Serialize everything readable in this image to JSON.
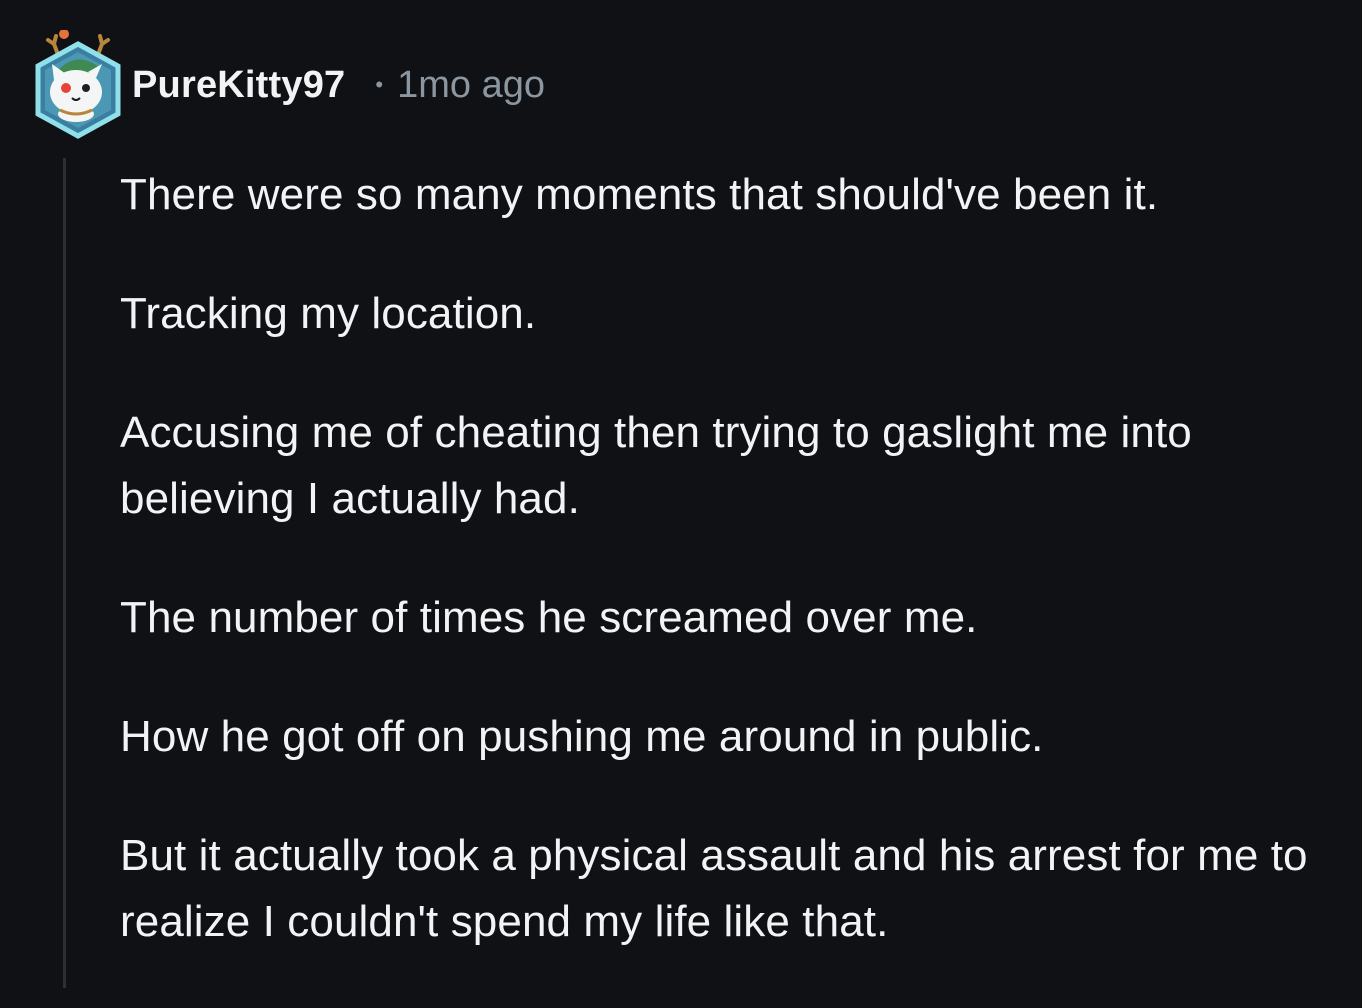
{
  "comment": {
    "avatar_icon": "kitty-avatar-icon",
    "username": "PureKitty97",
    "separator": "•",
    "timestamp": "1mo ago",
    "paragraphs": [
      "There were so many moments that should've been it.",
      "Tracking my location.",
      "Accusing me of cheating then trying to gaslight me into believing I actually had.",
      "The number of times he screamed over me.",
      "How he got off on pushing me around in public.",
      "But it actually took a physical assault and his arrest for me to realize I couldn't spend my life like that."
    ]
  },
  "colors": {
    "background": "#0f1114",
    "text": "#f2f3f5",
    "meta": "#8b96a0",
    "thread_line": "#2a3036",
    "avatar_frame": "#6fd3e0"
  }
}
